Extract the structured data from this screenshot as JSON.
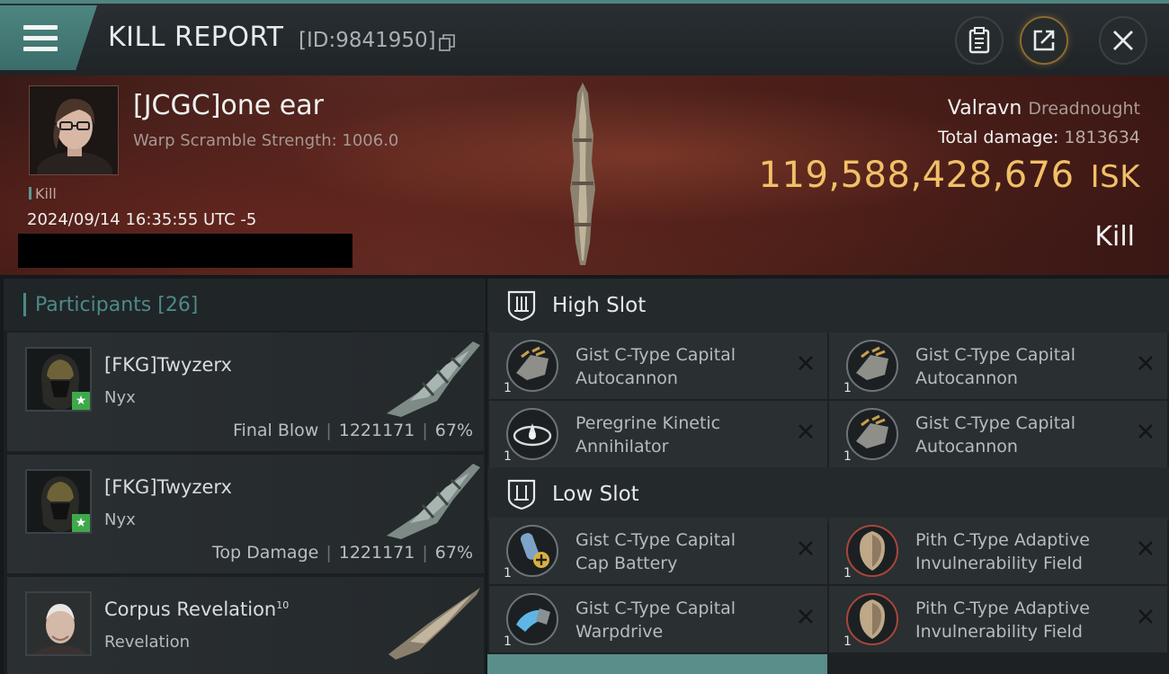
{
  "header": {
    "title": "KILL REPORT",
    "report_id": "[ID:9841950]"
  },
  "victim": {
    "name": "[JCGC]one ear",
    "warp_scramble": "Warp Scramble Strength: 1006.0",
    "tag": "Kill",
    "timestamp": "2024/09/14 16:35:55 UTC -5",
    "ship_name": "Valravn",
    "ship_class": "Dreadnought",
    "total_damage_label": "Total damage:",
    "total_damage": "1813634",
    "isk_value": "119,588,428,676",
    "isk_unit": "ISK",
    "result": "Kill"
  },
  "participants": {
    "heading": "Participants",
    "count": "[26]",
    "rows": [
      {
        "name": "[FKG]Twyzerx",
        "ship": "Nyx",
        "role": "Final Blow",
        "damage": "1221171",
        "percent": "67%"
      },
      {
        "name": "[FKG]Twyzerx",
        "ship": "Nyx",
        "role": "Top Damage",
        "damage": "1221171",
        "percent": "67%"
      },
      {
        "name": "Corpus Revelation",
        "level": "10",
        "ship": "Revelation"
      }
    ]
  },
  "fitting": {
    "high_slot_label": "High Slot",
    "low_slot_label": "Low Slot",
    "high_modules": [
      {
        "line1": "Gist C-Type Capital",
        "line2": "Autocannon",
        "qty": "1"
      },
      {
        "line1": "Gist C-Type Capital",
        "line2": "Autocannon",
        "qty": "1"
      },
      {
        "line1": "Peregrine Kinetic",
        "line2": "Annihilator",
        "qty": "1"
      },
      {
        "line1": "Gist C-Type Capital",
        "line2": "Autocannon",
        "qty": "1"
      }
    ],
    "low_modules": [
      {
        "line1": "Gist C-Type Capital",
        "line2": "Cap Battery",
        "qty": "1"
      },
      {
        "line1": "Pith C-Type Adaptive",
        "line2": "Invulnerability Field",
        "qty": "1"
      },
      {
        "line1": "Gist C-Type Capital",
        "line2": "Warpdrive",
        "qty": "1"
      },
      {
        "line1": "Pith C-Type Adaptive",
        "line2": "Invulnerability Field",
        "qty": "1"
      }
    ]
  },
  "colors": {
    "accent_teal": "#4f8580",
    "isk_gold": "#f1c067",
    "star_green": "#3fa84a"
  }
}
